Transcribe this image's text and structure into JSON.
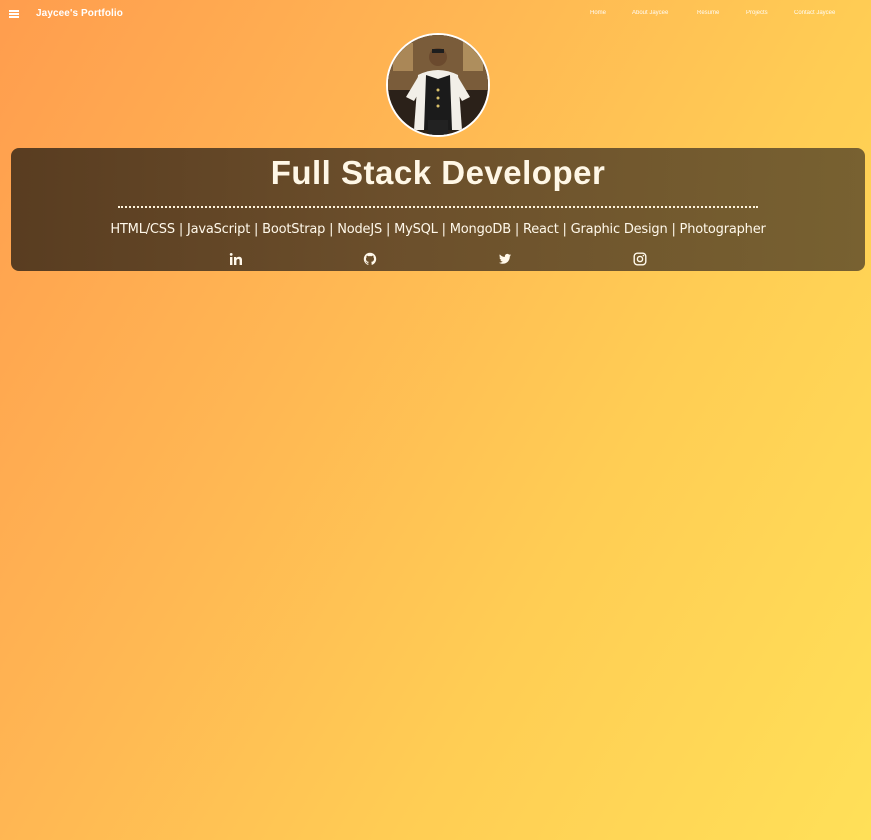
{
  "navbar": {
    "brand": "Jaycee's Portfolio",
    "menu_icon": "hamburger-menu-icon",
    "links": [
      "Home",
      "About Jaycee",
      "Resume",
      "Projects",
      "Contact Jaycee"
    ]
  },
  "profile": {
    "avatar_alt": "profile-photo"
  },
  "hero": {
    "title": "Full Stack Developer",
    "skills": "HTML/CSS | JavaScript | BootStrap | NodeJS | MySQL | MongoDB | React | Graphic Design | Photographer"
  },
  "social": {
    "icons": [
      "linkedin-icon",
      "github-icon",
      "twitter-icon",
      "instagram-icon"
    ]
  },
  "colors": {
    "background_start": "#ff9d4e",
    "background_end": "#ffe058",
    "hero_panel": "#5a3f24",
    "text_light": "#fff7e6"
  }
}
